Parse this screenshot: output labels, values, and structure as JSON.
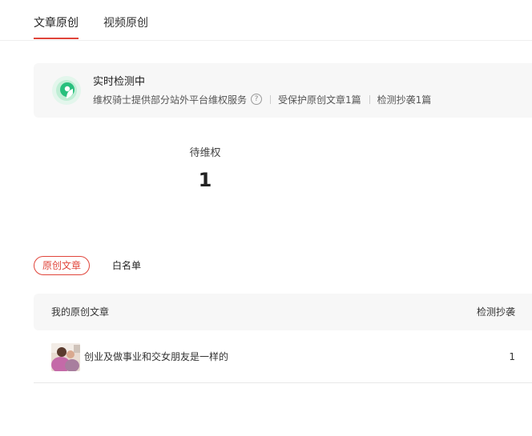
{
  "tabs": [
    {
      "label": "文章原创",
      "active": true
    },
    {
      "label": "视频原创",
      "active": false
    }
  ],
  "status": {
    "title": "实时检测中",
    "description": "维权骑士提供部分站外平台维权服务",
    "help_icon": "question-circle-icon",
    "protected": "受保护原创文章1篇",
    "plagiarism": "检测抄袭1篇"
  },
  "stat": {
    "label": "待维权",
    "value": "1"
  },
  "segments": [
    {
      "label": "原创文章",
      "active": true
    },
    {
      "label": "白名单",
      "active": false
    }
  ],
  "table": {
    "columns": [
      "我的原创文章",
      "检测抄袭"
    ],
    "rows": [
      {
        "title": "创业及做事业和交女朋友是一样的",
        "count": "1"
      }
    ]
  },
  "colors": {
    "accent": "#e0443a",
    "status_icon": "#27c07d",
    "panel_bg": "#f7f7f7"
  }
}
